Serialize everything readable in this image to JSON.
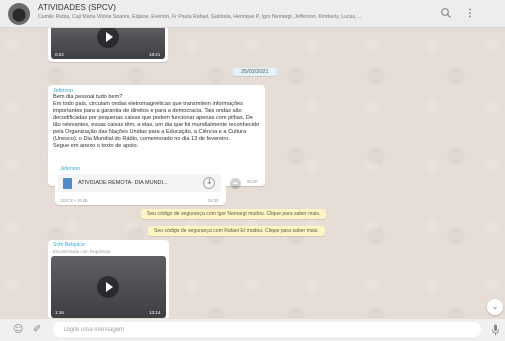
{
  "header": {
    "title": "ATIVIDADES (SPCV)",
    "members": "Camile Rubia, Caji Maria Vitória Soares, Edjane, Everton, Fr Paula Rafael, Gabriela, Henrique P, Igor Nemargi, Jefferson, Kimberly, Lucas, ...",
    "search_icon": "search-icon",
    "menu_icon": "kebab-menu-icon"
  },
  "messages": {
    "top_video": {
      "duration": "0:22",
      "time": "19:21"
    },
    "date_separator": "25/02/2021",
    "text_message": {
      "sender": "Jeferson",
      "text": "Bem dia pessoal tudo bem?\nEm todo país, circulam ondas eletromagnéticas que transmitem informações importantes para a garantia de direitos e para a democracia. Tais ondas são decodificadas por pequenas caixas que podem funcionar apenas com pilhas. De tão relevantes, essas caixas têm, a elas, um dia que foi mundialmente reconhecido pela Organização das Nações Unidas para a Educação, a Ciência e a Cultura (Unesco): o Dia Mundial do Rádio, comemorado no dia 13 de fevereiro.\nSegue em anexo o texto de apoio.",
      "time": "08:30"
    },
    "doc_message": {
      "sender": "Jeferson",
      "filename": "ATIVIDADE REMOTA- DIA MUNDI...",
      "meta": "DOCX • 18 kB",
      "time": "08:30"
    },
    "system": [
      "Seu código de segurança com Igor Nemargi mudou. Clique para saber mais.",
      "Seu código de segurança com Rafael Et mudou. Clique para saber mais."
    ],
    "forward_message": {
      "sender": "Scfe Belquice",
      "forwarded_label": "Encaminhada com frequência",
      "duration": "1:16",
      "time": "13:14"
    }
  },
  "footer": {
    "placeholder": "Digite uma mensagem",
    "emoji_icon": "emoji-icon",
    "attach_icon": "paperclip-icon",
    "mic_icon": "microphone-icon"
  }
}
